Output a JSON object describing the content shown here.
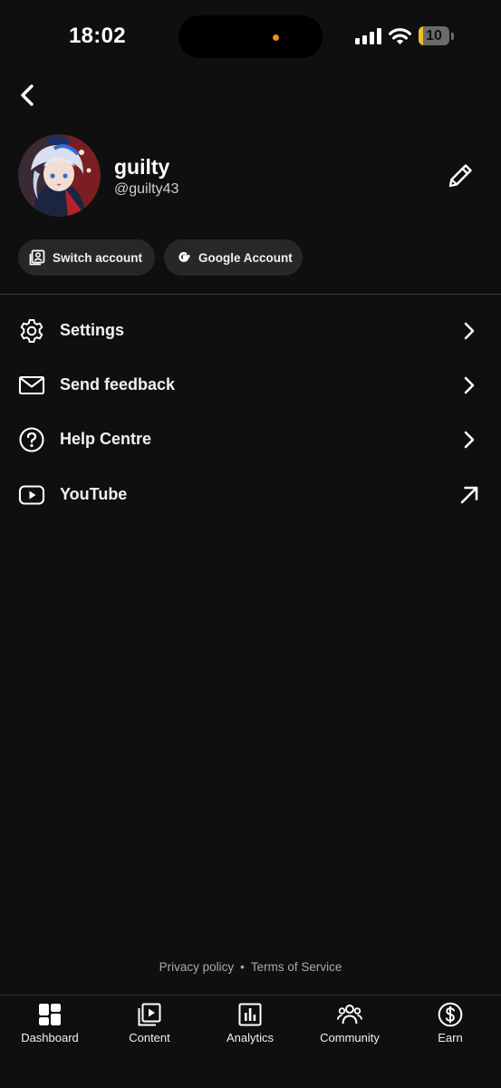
{
  "status_bar": {
    "time": "18:02",
    "battery": "10",
    "battery_level_percent": 10,
    "island_dot_color": "#f08a1c"
  },
  "profile": {
    "name": "guilty",
    "handle": "@guilty43"
  },
  "chips": {
    "switch_account": "Switch account",
    "google_account": "Google Account"
  },
  "menu": [
    {
      "label": "Settings",
      "icon": "gear-icon",
      "trailing": "chevron-right-icon"
    },
    {
      "label": "Send feedback",
      "icon": "mail-icon",
      "trailing": "chevron-right-icon"
    },
    {
      "label": "Help Centre",
      "icon": "help-circle-icon",
      "trailing": "chevron-right-icon"
    },
    {
      "label": "YouTube",
      "icon": "youtube-icon",
      "trailing": "external-arrow-icon"
    }
  ],
  "footer": {
    "privacy": "Privacy policy",
    "separator": "•",
    "terms": "Terms of Service"
  },
  "bottom_nav": [
    {
      "label": "Dashboard",
      "icon": "dashboard-icon"
    },
    {
      "label": "Content",
      "icon": "content-icon"
    },
    {
      "label": "Analytics",
      "icon": "analytics-icon"
    },
    {
      "label": "Community",
      "icon": "community-icon"
    },
    {
      "label": "Earn",
      "icon": "dollar-icon"
    }
  ],
  "colors": {
    "background": "#0f0f0f",
    "chip": "#272727",
    "text": "#f1f1f1",
    "muted": "#aaaaaa"
  }
}
